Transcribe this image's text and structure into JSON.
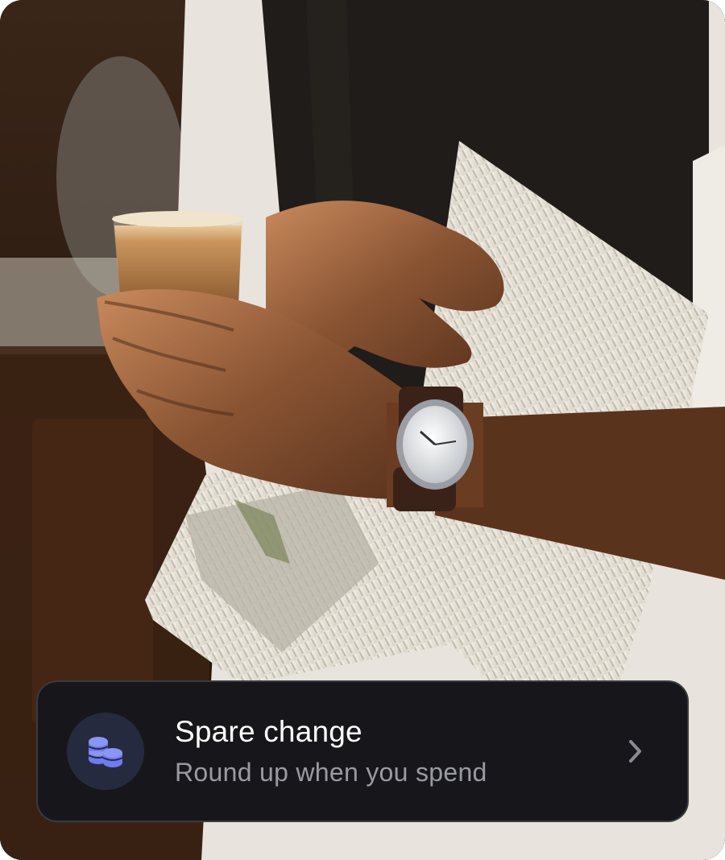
{
  "card": {
    "title": "Spare change",
    "subtitle": "Round up when you spend",
    "icon": "coins-icon",
    "action_icon": "chevron-right-icon"
  },
  "colors": {
    "card_background": "#17171b",
    "icon_accent": "#6d7cf0",
    "icon_circle": "#262a3f",
    "subtitle": "#9a9aa2"
  }
}
